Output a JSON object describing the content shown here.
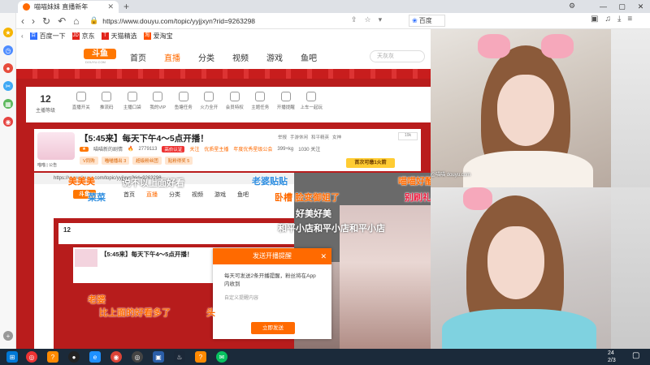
{
  "browser": {
    "tab_title": "喵喵妹妹 直播新年",
    "new_tab": "+",
    "url": "https://www.douyu.com/topic/yyjjxyn?rid=9263298",
    "search_engine": "百度",
    "bookmarks": [
      {
        "label": "百度一下",
        "color": "#2f6fff",
        "glyph": "百"
      },
      {
        "label": "京东",
        "color": "#e2231a",
        "glyph": "JD"
      },
      {
        "label": "天猫精选",
        "color": "#e2231a",
        "glyph": "T"
      },
      {
        "label": "爱淘宝",
        "color": "#ff5000",
        "glyph": "淘"
      }
    ],
    "nav_icons": [
      "back-icon",
      "forward-icon",
      "refresh-icon",
      "undo-icon",
      "home-icon"
    ],
    "window_controls": [
      "minimize-icon",
      "maximize-icon",
      "close-icon"
    ]
  },
  "site": {
    "logo_text": "斗鱼",
    "logo_sub": "DOUYU.COM",
    "nav": [
      "首页",
      "直播",
      "分类",
      "视频",
      "游戏",
      "鱼吧"
    ],
    "search_placeholder": "天灰灰"
  },
  "toolbar": {
    "level_num": "12",
    "level_label": "主播等级",
    "tools": [
      "直播开关",
      "推流码",
      "主播口袋",
      "我的VIP",
      "鱼塘任务",
      "火力全开",
      "会员特权",
      "主题任务",
      "开播提醒",
      "上车一起玩"
    ]
  },
  "room": {
    "title": "【5:45来】每天下午4～5点开播！",
    "avatar_caption": "喵喵 | 公告",
    "tags": [
      "举报",
      "手游休闲",
      "和平精英",
      "女神"
    ],
    "anchor_name": "喵喵新的剧情",
    "hot_count": "2779113",
    "pill_follow": "高价认证",
    "extra": [
      "关注",
      "优质星主播",
      "年度优秀星级公会"
    ],
    "fans": "399+kg",
    "fans_label": "1030 关注",
    "actions": [
      "V同购",
      "喵喵播出 3",
      "超级粉丝团",
      "贴粉得奖 5"
    ],
    "hot_badge": "首次可缴1火箭",
    "count_badge": "19k"
  },
  "nested": {
    "url": "https://www.douyu.com/topic/yyjjxyn?rid=9263298",
    "nav": [
      "首页",
      "直播",
      "分类",
      "视频",
      "游戏",
      "鱼吧"
    ],
    "level": "12",
    "title": "【5:45来】每天下午4～5点开播！"
  },
  "popup": {
    "title": "发送开播提醒",
    "body": "每天可发送2条开播提醒，粉丝将在App内收到",
    "sub": "自定义提醒内容",
    "button": "立即发送"
  },
  "danmu": [
    {
      "text": "美美美",
      "color": "#ff6a00"
    },
    {
      "text": "说不以上面好看",
      "color": "#ffffff"
    },
    {
      "text": "老婆贴贴",
      "color": "#2f8ee0"
    },
    {
      "text": "喵喵好酷",
      "color": "#ff6a00"
    },
    {
      "text": "卧槽 脸变御姐了",
      "color": "#ff6a00"
    },
    {
      "text": "别刷礼",
      "color": "#e24"
    },
    {
      "text": "菜菜",
      "color": "#2f8ee0"
    },
    {
      "text": "好美好美",
      "color": "#ffffff"
    },
    {
      "text": "和平小店和平小店和平小店",
      "color": "#ffffff"
    },
    {
      "text": "老婆",
      "color": "#ff6a00"
    },
    {
      "text": "比上面的好看多了",
      "color": "#ff6a00"
    },
    {
      "text": "头",
      "color": "#ff6a00"
    }
  ],
  "cam": {
    "caption": "@喵喵 douyu.com"
  },
  "taskbar": {
    "time": "24",
    "date": "2/3"
  },
  "colors": {
    "accent": "#ff6a00",
    "page_red": "#b91c1c",
    "taskbar": "#1b2a3a"
  }
}
